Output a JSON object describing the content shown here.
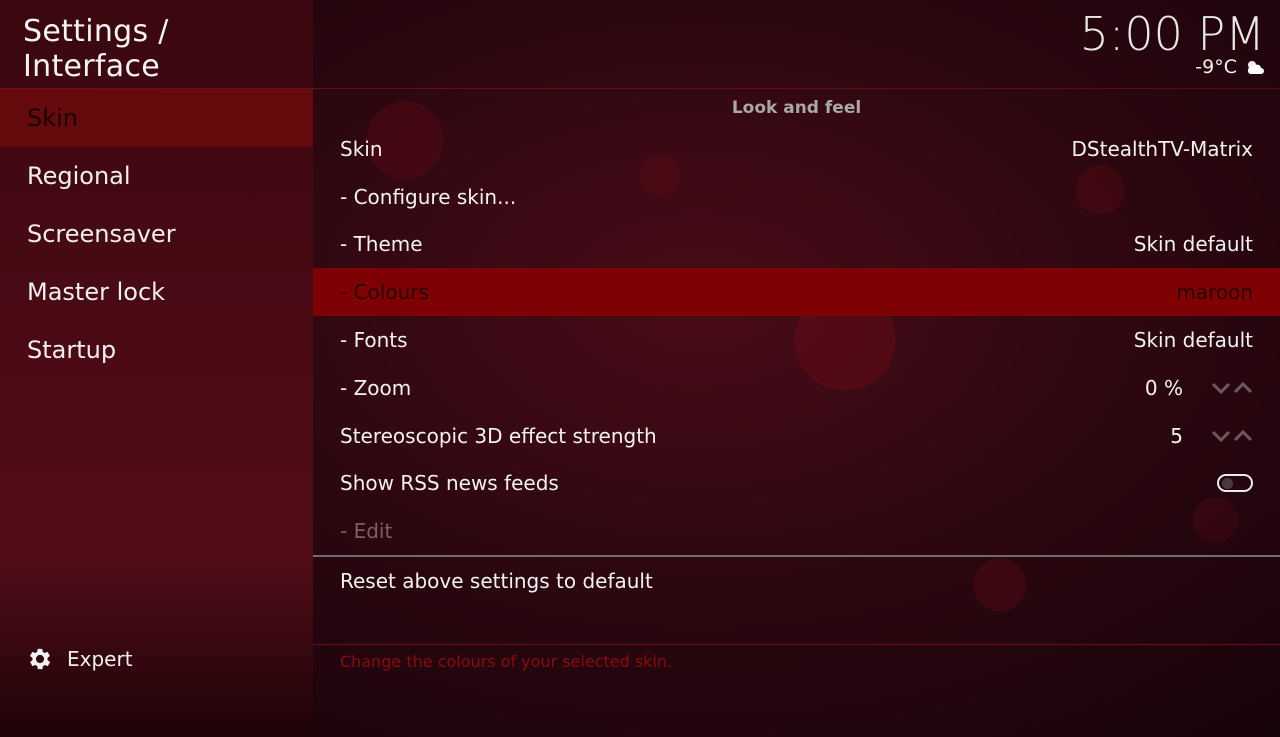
{
  "header": {
    "title": "Settings / Interface"
  },
  "clock": {
    "time": "5:00 PM",
    "temperature": "-9°C",
    "weather_icon": "partly-cloudy-icon"
  },
  "sidebar": {
    "items": [
      {
        "label": "Skin",
        "active": true
      },
      {
        "label": "Regional"
      },
      {
        "label": "Screensaver"
      },
      {
        "label": "Master lock"
      },
      {
        "label": "Startup"
      }
    ],
    "expert_label": "Expert",
    "expert_icon": "gear-icon"
  },
  "main": {
    "section_title": "Look and feel",
    "rows": [
      {
        "label": "Skin",
        "value": "DStealthTV-Matrix"
      },
      {
        "label": "- Configure skin...",
        "value": ""
      },
      {
        "label": "- Theme",
        "value": "Skin default"
      },
      {
        "label": "- Colours",
        "value": "maroon",
        "focused": true
      },
      {
        "label": "- Fonts",
        "value": "Skin default"
      },
      {
        "label": "- Zoom",
        "value": "0 %",
        "control": "spinner"
      },
      {
        "label": "Stereoscopic 3D effect strength",
        "value": "5",
        "control": "spinner"
      },
      {
        "label": "Show RSS news feeds",
        "value": "",
        "control": "toggle",
        "toggle_on": false
      },
      {
        "label": "- Edit",
        "value": "",
        "disabled": true
      }
    ],
    "reset_label": "Reset above settings to default",
    "hint": "Change the colours of your selected skin."
  },
  "colors": {
    "accent": "#7e0204",
    "sidebar_active": "#650a0d",
    "hint_text": "#8b0a0e",
    "background": "#2d0710"
  }
}
